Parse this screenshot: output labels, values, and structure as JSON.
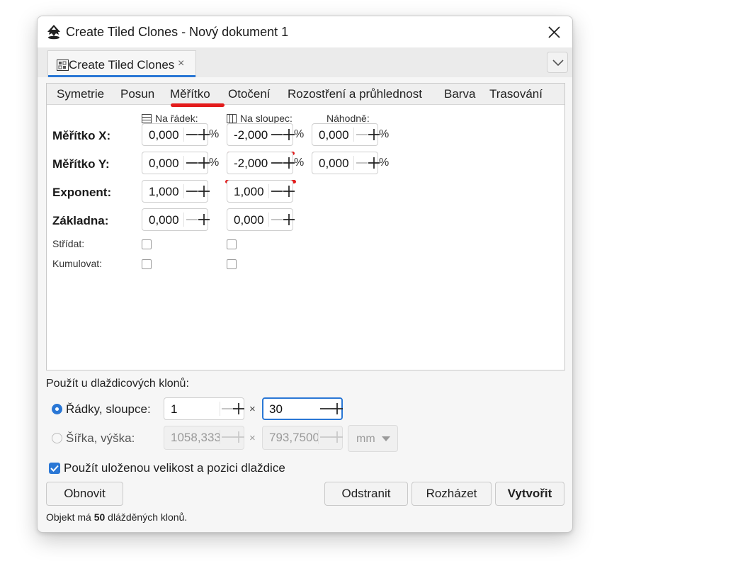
{
  "window": {
    "title": "Create Tiled Clones - Nový dokument 1",
    "icon": "inkscape-logo-icon"
  },
  "dock": {
    "tab_label": "Create Tiled Clones",
    "tab_close": "×",
    "menu_icon": "chevron-down-icon"
  },
  "tabs": [
    {
      "label": "Symetrie"
    },
    {
      "label": "Posun"
    },
    {
      "label": "Měřítko",
      "active": true
    },
    {
      "label": "Otočení"
    },
    {
      "label": "Rozostření a průhlednost"
    },
    {
      "label": "Barva"
    },
    {
      "label": "Trasování"
    }
  ],
  "scale": {
    "col_headers": {
      "row": "Na řádek:",
      "column": "Na sloupec:",
      "random": "Náhodně:"
    },
    "rows": [
      {
        "label": "Měřítko X:",
        "row_value": "0,000",
        "column_value": "-2,000",
        "random_value": "0,000",
        "unit": "%"
      },
      {
        "label": "Měřítko Y:",
        "row_value": "0,000",
        "column_value": "-2,000",
        "random_value": "0,000",
        "unit": "%"
      },
      {
        "label": "Exponent:",
        "row_value": "1,000",
        "column_value": "1,000"
      },
      {
        "label": "Základna:",
        "row_value": "0,000",
        "column_value": "0,000"
      }
    ],
    "alternate_label": "Střídat:",
    "cumulate_label": "Kumulovat:"
  },
  "apply": {
    "section_label": "Použít u dlaždicových klonů:",
    "rows_cols_label": "Řádky, sloupce:",
    "rows_value": "1",
    "cols_value": "30",
    "width_height_label": "Šířka, výška:",
    "width_value": "1058,333",
    "height_value": "793,7500",
    "unit": "mm",
    "times": "×",
    "use_saved_label": "Použít uloženou velikost a pozici dlaždice",
    "use_saved_checked": true
  },
  "buttons": {
    "reset": "Obnovit",
    "remove": "Odstranit",
    "unclump": "Rozházet",
    "create": "Vytvořit"
  },
  "status": {
    "prefix": "Objekt má ",
    "count": "50",
    "suffix": " dlážděných klonů."
  },
  "colors": {
    "accent": "#2a77d5",
    "annotation_red": "#e31b1b"
  }
}
